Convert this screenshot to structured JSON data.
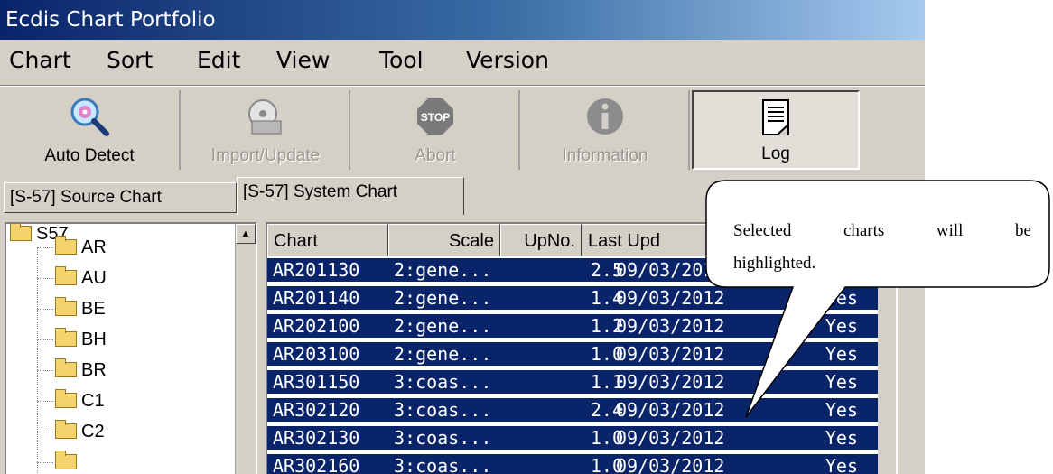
{
  "window": {
    "title": "Ecdis Chart Portfolio"
  },
  "menu": [
    "Chart",
    "Sort",
    "Edit",
    "View",
    "Tool",
    "Version"
  ],
  "toolbar": [
    {
      "label": "Auto Detect",
      "icon": "magnifier-cd-icon",
      "enabled": true
    },
    {
      "label": "Import/Update",
      "icon": "disk-import-icon",
      "enabled": false
    },
    {
      "label": "Abort",
      "icon": "stop-sign-icon",
      "enabled": false
    },
    {
      "label": "Information",
      "icon": "info-icon",
      "enabled": false
    },
    {
      "label": "Log",
      "icon": "log-document-icon",
      "enabled": true,
      "pressed": true
    }
  ],
  "tabs": [
    {
      "label": "[S-57] Source Chart",
      "selected": false
    },
    {
      "label": "[S-57] System Chart",
      "selected": true
    }
  ],
  "tree": {
    "root": "S57",
    "folders": [
      "AR",
      "AU",
      "BE",
      "BH",
      "BR",
      "C1",
      "C2"
    ]
  },
  "table": {
    "columns": [
      "Chart",
      "Scale",
      "UpNo.",
      "Last Upd"
    ],
    "rows": [
      {
        "chart": "AR201130",
        "scale": "2:gene...",
        "upno": "2.5",
        "last": "09/03/201",
        "flag": ""
      },
      {
        "chart": "AR201140",
        "scale": "2:gene...",
        "upno": "1.4",
        "last": "09/03/2012",
        "flag": "Yes"
      },
      {
        "chart": "AR202100",
        "scale": "2:gene...",
        "upno": "1.2",
        "last": "09/03/2012",
        "flag": "Yes"
      },
      {
        "chart": "AR203100",
        "scale": "2:gene...",
        "upno": "1.0",
        "last": "09/03/2012",
        "flag": "Yes"
      },
      {
        "chart": "AR301150",
        "scale": "3:coas...",
        "upno": "1.1",
        "last": "09/03/2012",
        "flag": "Yes"
      },
      {
        "chart": "AR302120",
        "scale": "3:coas...",
        "upno": "2.4",
        "last": "09/03/2012",
        "flag": "Yes"
      },
      {
        "chart": "AR302130",
        "scale": "3:coas...",
        "upno": "1.0",
        "last": "09/03/2012",
        "flag": "Yes"
      },
      {
        "chart": "AR302160",
        "scale": "3:coas...",
        "upno": "1.0",
        "last": "09/03/2012",
        "flag": "Yes"
      }
    ]
  },
  "callout": {
    "line1_words": [
      "Selected",
      "charts",
      "will",
      "be"
    ],
    "line2": "highlighted."
  },
  "colors": {
    "selection": "#0a246a",
    "face": "#d4d0c8",
    "title_start": "#0a246a"
  }
}
